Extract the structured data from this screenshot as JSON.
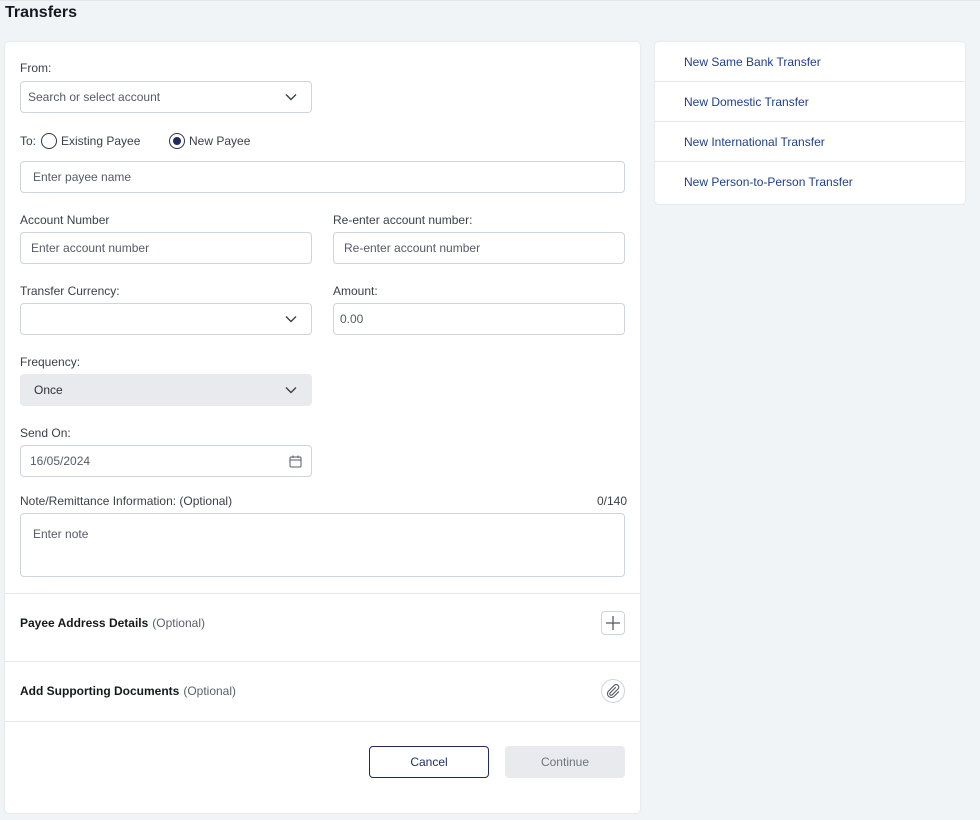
{
  "page": {
    "title": "Transfers"
  },
  "form": {
    "from": {
      "label": "From:",
      "placeholder": "Search or select account"
    },
    "to": {
      "label": "To:",
      "options": [
        "Existing Payee",
        "New Payee"
      ],
      "selected": "New Payee",
      "payee_placeholder": "Enter payee name"
    },
    "account_number": {
      "label": "Account Number",
      "placeholder": "Enter account number"
    },
    "reenter_account": {
      "label": "Re-enter account number:",
      "placeholder": "Re-enter account number"
    },
    "currency": {
      "label": "Transfer Currency:",
      "value": ""
    },
    "amount": {
      "label": "Amount:",
      "placeholder": "0.00"
    },
    "frequency": {
      "label": "Frequency:",
      "value": "Once"
    },
    "send_on": {
      "label": "Send On:",
      "value": "16/05/2024"
    },
    "note": {
      "label": "Note/Remittance Information: (Optional)",
      "counter": "0/140",
      "placeholder": "Enter note"
    },
    "payee_address": {
      "title": "Payee Address Details",
      "optional": "(Optional)"
    },
    "supporting_docs": {
      "title": "Add Supporting Documents",
      "optional": "(Optional)"
    },
    "buttons": {
      "cancel": "Cancel",
      "continue": "Continue"
    }
  },
  "sidebar": {
    "links": [
      {
        "label": "New Same Bank Transfer"
      },
      {
        "label": "New Domestic Transfer"
      },
      {
        "label": "New International Transfer"
      },
      {
        "label": "New Person-to-Person Transfer"
      }
    ]
  },
  "colors": {
    "accent": "#1f2b5e",
    "link": "#1f3f8a",
    "background": "#f1f4f7"
  },
  "icons": [
    "chevron-down-icon",
    "calendar-icon",
    "plus-icon",
    "paperclip-icon"
  ]
}
